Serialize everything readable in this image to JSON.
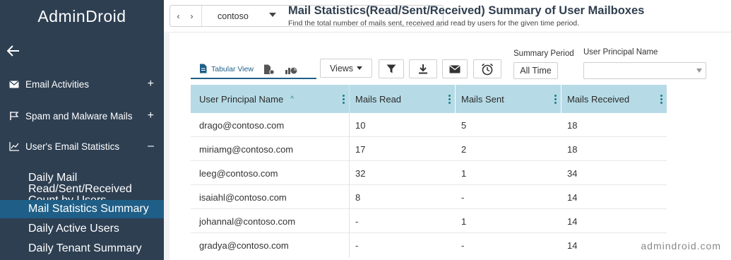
{
  "sidebar": {
    "logo": "AdminDroid",
    "menu": [
      {
        "label": "Email Activities",
        "sign": "+"
      },
      {
        "label": "Spam and Malware Mails",
        "sign": "+"
      },
      {
        "label": "User's Email Statistics",
        "sign": "–"
      }
    ],
    "submenu": [
      {
        "label_line1": "Daily Mail Read/Sent/Received",
        "label_line2": "Count by Users"
      },
      {
        "label": "Mail Statistics Summary"
      },
      {
        "label": "Daily Active Users"
      },
      {
        "label": "Daily Tenant Summary"
      }
    ]
  },
  "header": {
    "prev_label": "‹",
    "next_label": "›",
    "tenant": "contoso",
    "title": "Mail Statistics(Read/Sent/Received) Summary of User Mailboxes",
    "subtitle": "Find the total number of mails sent, received and read by users for the given time period."
  },
  "toolbar": {
    "tabular_view_label": "Tabular View",
    "views_label": "Views",
    "summary_period_label": "Summary Period",
    "summary_period_value": "All Time",
    "upn_label": "User Principal Name",
    "upn_value": ""
  },
  "table": {
    "columns": [
      "User Principal Name",
      "Mails Read",
      "Mails Sent",
      "Mails Received"
    ],
    "rows": [
      [
        "drago@contoso.com",
        "10",
        "5",
        "18"
      ],
      [
        "miriamg@contoso.com",
        "17",
        "2",
        "18"
      ],
      [
        "leeg@contoso.com",
        "32",
        "1",
        "34"
      ],
      [
        "isaiahl@contoso.com",
        "8",
        "-",
        "14"
      ],
      [
        "johannal@contoso.com",
        "-",
        "1",
        "14"
      ],
      [
        "gradya@contoso.com",
        "-",
        "-",
        "14"
      ]
    ]
  },
  "watermark": "admindroid.com",
  "colors": {
    "sidebar_bg": "#2e3f52",
    "active_item_bg": "#1f5f87",
    "table_header_bg": "#b6dbe6",
    "accent": "#1f5f87"
  }
}
